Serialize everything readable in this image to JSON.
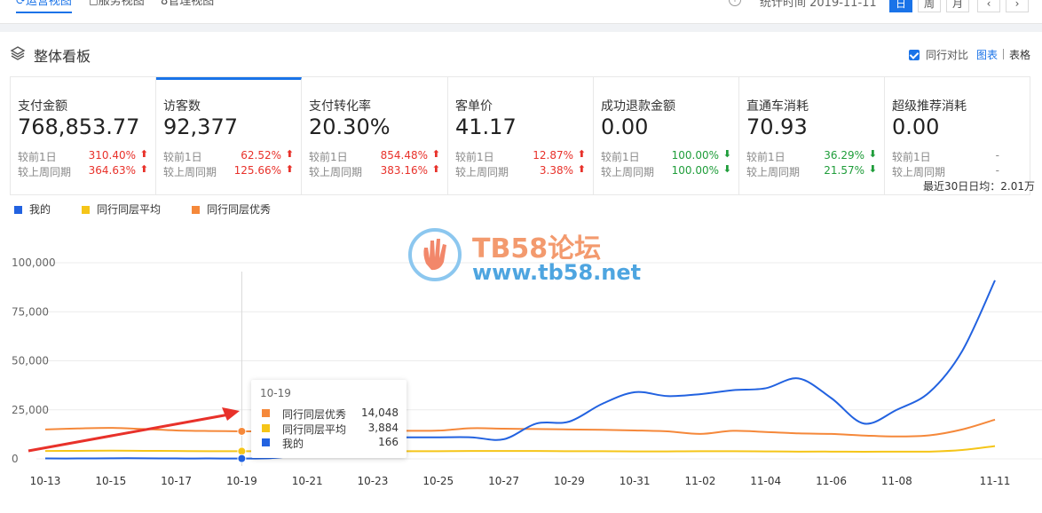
{
  "topbar": {
    "tabs": [
      {
        "label": "运营视图",
        "icon": "trend-icon"
      },
      {
        "label": "服务视图",
        "icon": "service-icon"
      },
      {
        "label": "管理视图",
        "icon": "manage-icon"
      }
    ],
    "stat_time": "统计时间 2019-11-11",
    "periods": [
      "日",
      "周",
      "月"
    ],
    "prev": "‹",
    "next": "›"
  },
  "board": {
    "title": "整体看板",
    "peer_compare": "同行对比",
    "chart_link": "图表",
    "table_link": "表格"
  },
  "metrics": [
    {
      "label": "支付金额",
      "value": "768,853.77",
      "row1_label": "较前1日",
      "row1_pct": "310.40%",
      "row1_dir": "up",
      "row2_label": "较上周同期",
      "row2_pct": "364.63%",
      "row2_dir": "up"
    },
    {
      "label": "访客数",
      "value": "92,377",
      "row1_label": "较前1日",
      "row1_pct": "62.52%",
      "row1_dir": "up",
      "row2_label": "较上周同期",
      "row2_pct": "125.66%",
      "row2_dir": "up"
    },
    {
      "label": "支付转化率",
      "value": "20.30%",
      "row1_label": "较前1日",
      "row1_pct": "854.48%",
      "row1_dir": "up",
      "row2_label": "较上周同期",
      "row2_pct": "383.16%",
      "row2_dir": "up"
    },
    {
      "label": "客单价",
      "value": "41.17",
      "row1_label": "较前1日",
      "row1_pct": "12.87%",
      "row1_dir": "up",
      "row2_label": "较上周同期",
      "row2_pct": "3.38%",
      "row2_dir": "up"
    },
    {
      "label": "成功退款金额",
      "value": "0.00",
      "row1_label": "较前1日",
      "row1_pct": "100.00%",
      "row1_dir": "down",
      "row2_label": "较上周同期",
      "row2_pct": "100.00%",
      "row2_dir": "down"
    },
    {
      "label": "直通车消耗",
      "value": "70.93",
      "row1_label": "较前1日",
      "row1_pct": "36.29%",
      "row1_dir": "down",
      "row2_label": "较上周同期",
      "row2_pct": "21.57%",
      "row2_dir": "down"
    },
    {
      "label": "超级推荐消耗",
      "value": "0.00",
      "row1_label": "较前1日",
      "row1_pct": "-",
      "row1_dir": "none",
      "row2_label": "较上周同期",
      "row2_pct": "-",
      "row2_dir": "none"
    }
  ],
  "colors": {
    "mine": "#2262e0",
    "avg": "#f5c518",
    "excellent": "#f5883a",
    "accent": "#1a73e8",
    "up": "#e8312a",
    "down": "#1f9d3a"
  },
  "chart_data": {
    "type": "line",
    "avg_note": "最近30日日均：2.01万",
    "legend_position": "top-left",
    "grid": true,
    "x": [
      "10-13",
      "10-14",
      "10-15",
      "10-16",
      "10-17",
      "10-18",
      "10-19",
      "10-20",
      "10-21",
      "10-22",
      "10-23",
      "10-24",
      "10-25",
      "10-26",
      "10-27",
      "10-28",
      "10-29",
      "10-30",
      "10-31",
      "11-01",
      "11-02",
      "11-03",
      "11-04",
      "11-05",
      "11-06",
      "11-07",
      "11-08",
      "11-09",
      "11-10",
      "11-11"
    ],
    "x_tick_labels": [
      "10-13",
      "10-15",
      "10-17",
      "10-19",
      "10-21",
      "10-23",
      "10-25",
      "10-27",
      "10-29",
      "10-31",
      "11-02",
      "11-04",
      "11-06",
      "11-08",
      "11-11"
    ],
    "y_ticks": [
      "100,000",
      "75,000",
      "50,000",
      "25,000",
      "0"
    ],
    "ylim": [
      0,
      100000
    ],
    "series": [
      {
        "name": "我的",
        "key": "mine",
        "values": [
          200,
          200,
          300,
          300,
          200,
          200,
          166,
          500,
          3000,
          9000,
          11000,
          11000,
          11000,
          11000,
          10000,
          18000,
          19000,
          28000,
          34000,
          32000,
          33000,
          35000,
          36000,
          41000,
          31000,
          18000,
          25000,
          34000,
          55000,
          91000
        ]
      },
      {
        "name": "同行同层平均",
        "key": "avg",
        "values": [
          4000,
          4100,
          4200,
          4100,
          4000,
          3900,
          3884,
          3900,
          4000,
          4000,
          4000,
          3900,
          3900,
          4000,
          4000,
          4000,
          3900,
          3900,
          3800,
          3800,
          3900,
          3900,
          3800,
          3700,
          3700,
          3600,
          3700,
          3700,
          4500,
          6500
        ]
      },
      {
        "name": "同行同层优秀",
        "key": "excellent",
        "values": [
          15000,
          15500,
          15800,
          15200,
          14500,
          14200,
          14048,
          14100,
          14300,
          14400,
          14200,
          14300,
          14400,
          15600,
          15400,
          15200,
          15000,
          14800,
          14500,
          14000,
          12700,
          14300,
          13700,
          13000,
          12700,
          11900,
          11400,
          12000,
          15000,
          20000
        ]
      }
    ],
    "tooltip": {
      "date": "10-19",
      "rows": [
        {
          "name": "同行同层优秀",
          "value": "14,048",
          "key": "excellent"
        },
        {
          "name": "同行同层平均",
          "value": "3,884",
          "key": "avg"
        },
        {
          "name": "我的",
          "value": "166",
          "key": "mine"
        }
      ]
    }
  },
  "watermark": {
    "title": "TB58论坛",
    "url": "www.tb58.net"
  }
}
